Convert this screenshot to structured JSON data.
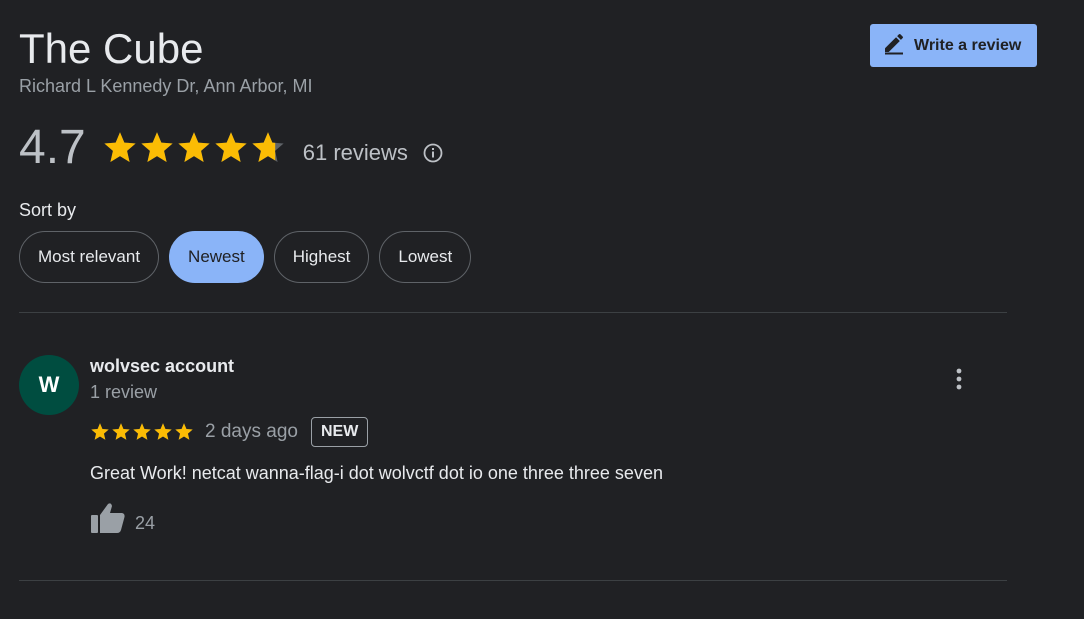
{
  "place": {
    "title": "The Cube",
    "address": "Richard L Kennedy Dr, Ann Arbor, MI"
  },
  "actions": {
    "write_review_label": "Write a review",
    "write_review_icon": "pencil-icon"
  },
  "rating": {
    "value": "4.7",
    "stars": 4.7,
    "review_count_label": "61 reviews",
    "info_icon": "info-icon",
    "star_color": "#fbbc04",
    "empty_star_color": "#5f6368"
  },
  "sort": {
    "label": "Sort by",
    "options": [
      {
        "label": "Most relevant",
        "active": false
      },
      {
        "label": "Newest",
        "active": true
      },
      {
        "label": "Highest",
        "active": false
      },
      {
        "label": "Lowest",
        "active": false
      }
    ]
  },
  "reviews": [
    {
      "avatar_letter": "W",
      "avatar_color": "#004d40",
      "author": "wolvsec account",
      "author_review_count": "1 review",
      "stars": 5,
      "date": "2 days ago",
      "badge": "NEW",
      "text": "Great Work! netcat wanna-flag-i dot wolvctf dot io one three three seven",
      "likes": "24",
      "like_icon": "thumbs-up-icon",
      "menu_icon": "more-vert-icon"
    }
  ],
  "colors": {
    "background": "#202124",
    "accent": "#8ab4f8",
    "text": "#e8eaed",
    "muted": "#9aa0a6",
    "divider": "#3c4043"
  }
}
